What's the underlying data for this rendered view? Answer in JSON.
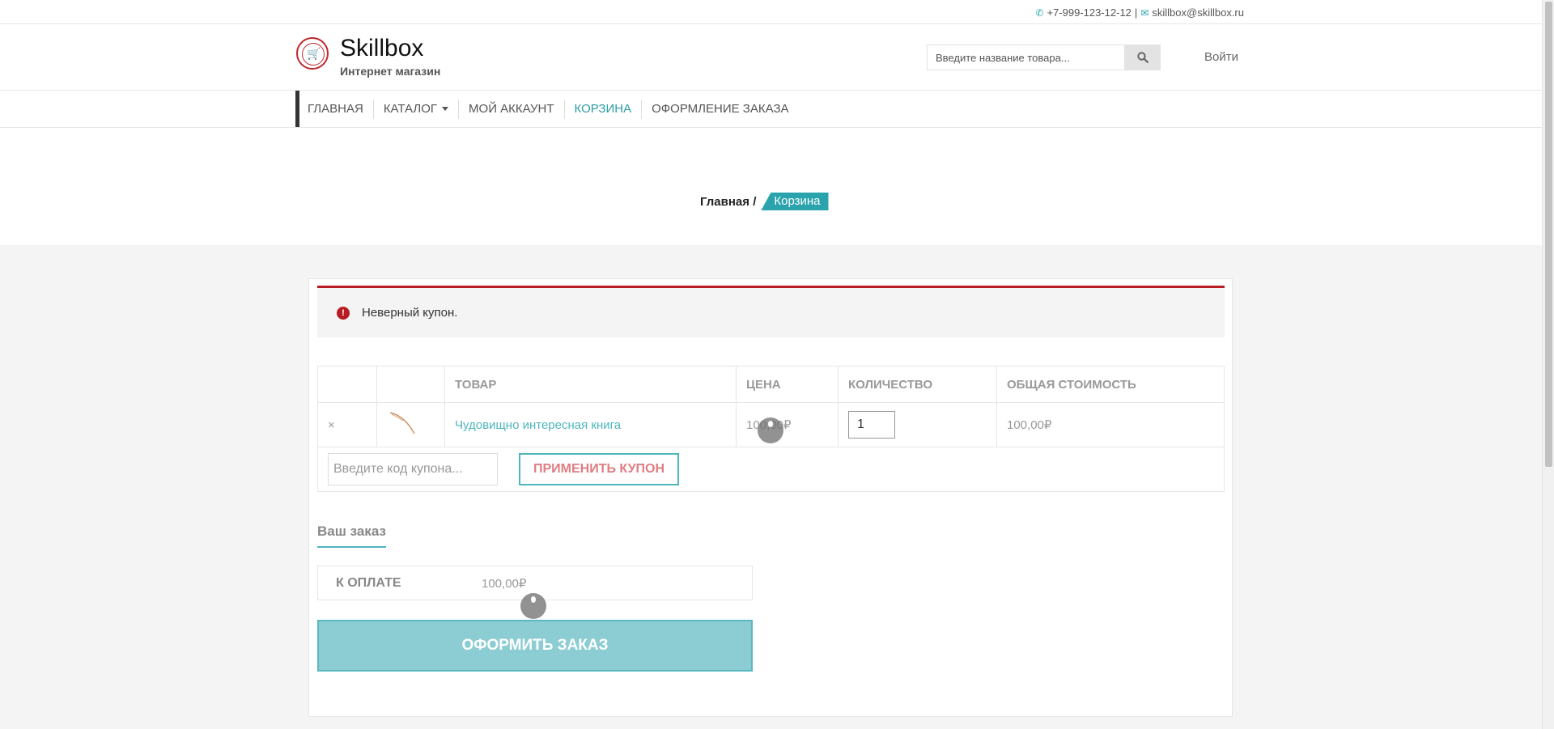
{
  "topbar": {
    "phone": "+7-999-123-12-12",
    "separator": "|",
    "email": "skillbox@skillbox.ru"
  },
  "header": {
    "brand": "Skillbox",
    "tagline": "Интернет магазин",
    "search_placeholder": "Введите название товара...",
    "login_label": "Войти"
  },
  "nav": {
    "items": [
      {
        "label": "Главная",
        "active": false
      },
      {
        "label": "Каталог",
        "active": false
      },
      {
        "label": "Мой аккаунт",
        "active": false
      },
      {
        "label": "Корзина",
        "active": true
      },
      {
        "label": "Оформление заказа",
        "active": false
      }
    ]
  },
  "breadcrumb": {
    "home": "Главная",
    "separator": "/",
    "current": "Корзина"
  },
  "alert": {
    "message": "Неверный купон."
  },
  "cart": {
    "columns": [
      "",
      "",
      "Товар",
      "Цена",
      "Количество",
      "Общая стоимость"
    ],
    "rows": [
      {
        "remove": "×",
        "product": "Чудовищно интересная книга",
        "price": "100,00₽",
        "quantity": "1",
        "subtotal": "100,00₽"
      }
    ],
    "coupon_placeholder": "Введите код купона...",
    "apply_coupon_label": "Применить купон"
  },
  "order": {
    "title": "Ваш заказ",
    "total_label": "К оплате",
    "total_value": "100,00₽",
    "checkout_label": "Оформить заказ"
  },
  "colors": {
    "accent": "#2aa3ad",
    "error": "#b81c23",
    "checkout_bg": "#8ccdd3"
  }
}
